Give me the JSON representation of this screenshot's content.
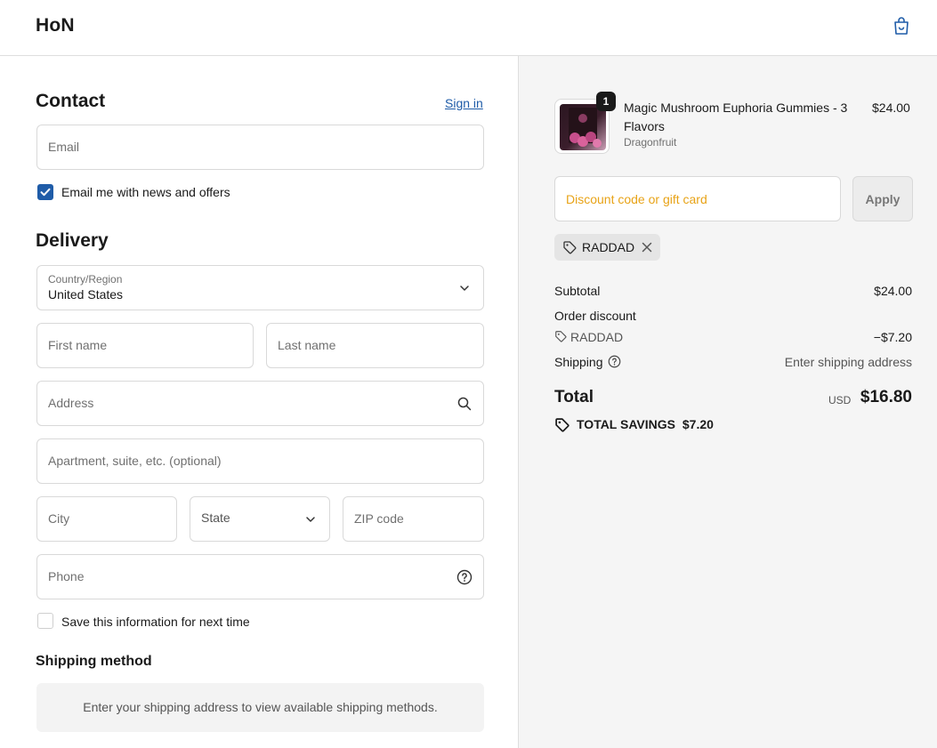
{
  "header": {
    "brand": "HoN",
    "cart_icon": "shopping-bag-icon"
  },
  "contact": {
    "heading": "Contact",
    "sign_in": "Sign in",
    "email_placeholder": "Email",
    "news_label": "Email me with news and offers",
    "news_checked": true
  },
  "delivery": {
    "heading": "Delivery",
    "country_label": "Country/Region",
    "country_value": "United States",
    "first_name": "First name",
    "last_name": "Last name",
    "address": "Address",
    "apartment": "Apartment, suite, etc. (optional)",
    "city": "City",
    "state": "State",
    "zip": "ZIP code",
    "phone": "Phone",
    "save_label": "Save this information for next time",
    "save_checked": false
  },
  "shipping_method": {
    "heading": "Shipping method",
    "message": "Enter your shipping address to view available shipping methods."
  },
  "summary": {
    "product": {
      "name": "Magic Mushroom Euphoria Gummies - 3 Flavors",
      "variant": "Dragonfruit",
      "price": "$24.00",
      "quantity": "1"
    },
    "discount_placeholder": "Discount code or gift card",
    "apply": "Apply",
    "applied_code": "RADDAD",
    "subtotal_label": "Subtotal",
    "subtotal_value": "$24.00",
    "order_discount_label": "Order discount",
    "discount_code": "RADDAD",
    "discount_value": "−$7.20",
    "shipping_label": "Shipping",
    "shipping_value": "Enter shipping address",
    "total_label": "Total",
    "currency": "USD",
    "total_value": "$16.80",
    "savings_label": "TOTAL SAVINGS",
    "savings_value": "$7.20"
  },
  "colors": {
    "accent": "#1f5ca8",
    "discount_placeholder": "#e8a317"
  }
}
